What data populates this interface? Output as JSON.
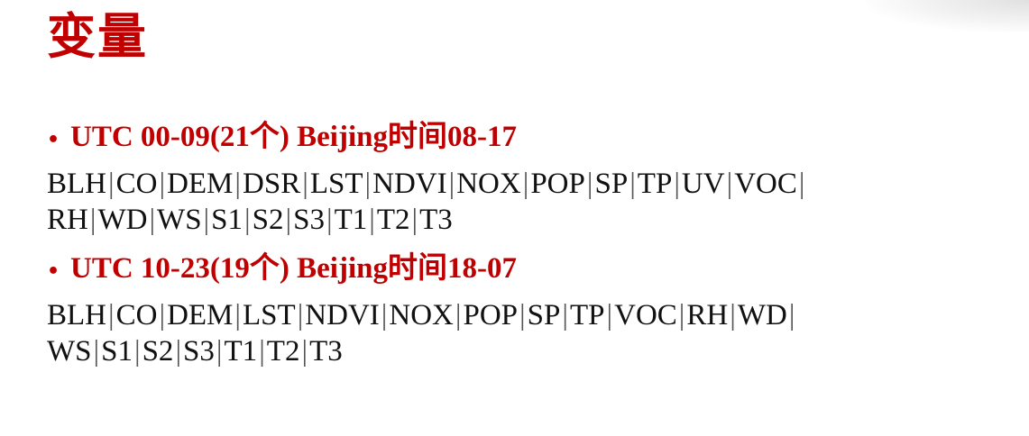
{
  "title": "变量",
  "sections": [
    {
      "heading": "UTC 00-09(21个) Beijing时间08-17",
      "lines": [
        [
          "BLH",
          "CO",
          "DEM",
          "DSR",
          "LST",
          "NDVI",
          "NOX",
          "POP",
          "SP",
          "TP",
          "UV",
          "VOC",
          ""
        ],
        [
          "RH",
          "WD",
          "WS",
          "S1",
          "S2",
          "S3",
          "T1",
          "T2",
          "T3"
        ]
      ]
    },
    {
      "heading": "UTC 10-23(19个) Beijing时间18-07",
      "lines": [
        [
          "BLH",
          "CO",
          "DEM",
          "LST",
          "NDVI",
          "NOX",
          "POP",
          "SP",
          "TP",
          "VOC",
          "RH",
          "WD",
          ""
        ],
        [
          "WS",
          "S1",
          "S2",
          "S3",
          "T1",
          "T2",
          "T3"
        ]
      ]
    }
  ],
  "separator": "|",
  "colors": {
    "accent": "#c00000",
    "text": "#111111"
  }
}
